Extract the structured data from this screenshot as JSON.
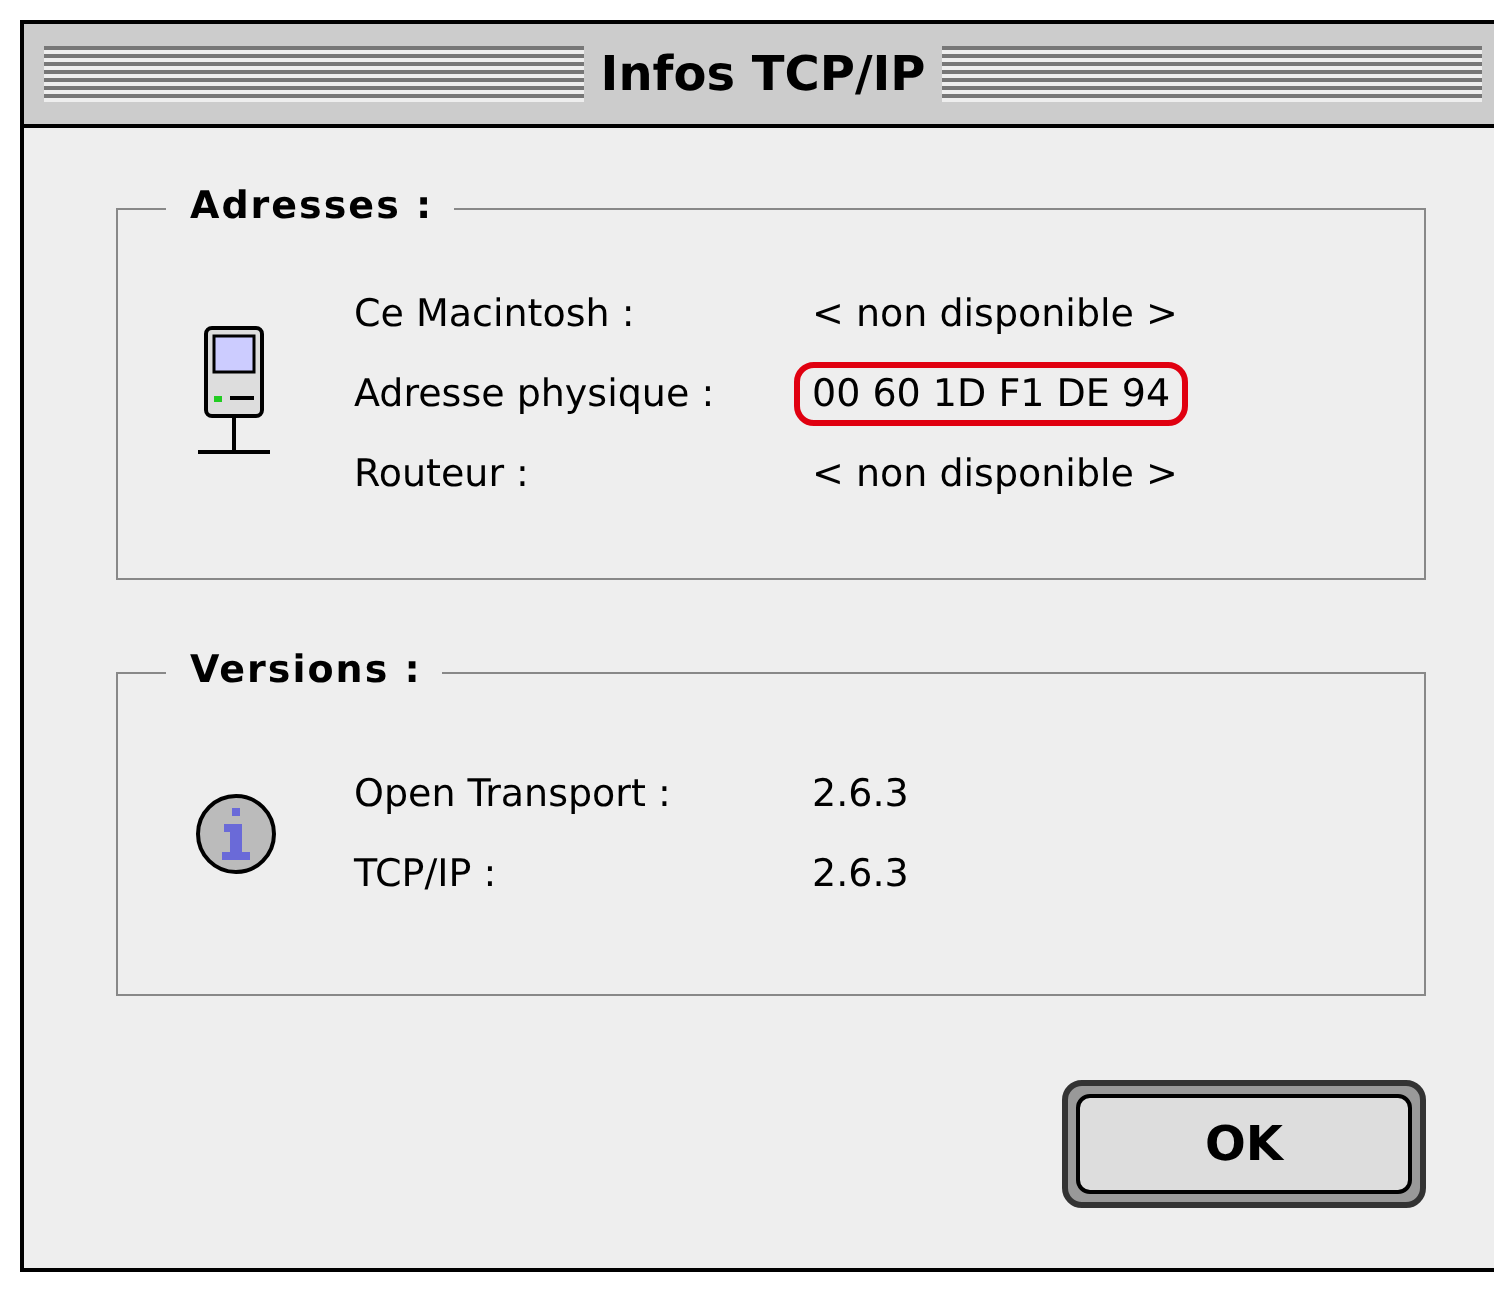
{
  "window": {
    "title": "Infos TCP/IP"
  },
  "groups": [
    {
      "title": "Adresses :",
      "kind": "computer",
      "rows": [
        {
          "label": "Ce Macintosh :",
          "value": "< non disponible >",
          "highlighted": false
        },
        {
          "label": "Adresse physique :",
          "value": "00 60 1D F1 DE 94",
          "highlighted": true
        },
        {
          "label": "Routeur :",
          "value": "< non disponible >",
          "highlighted": false
        }
      ]
    },
    {
      "title": "Versions :",
      "kind": "info",
      "rows": [
        {
          "label": "Open Transport :",
          "value": "2.6.3",
          "highlighted": false
        },
        {
          "label": "TCP/IP :",
          "value": "2.6.3",
          "highlighted": false
        }
      ]
    }
  ],
  "buttons": [
    {
      "label": "OK"
    }
  ]
}
